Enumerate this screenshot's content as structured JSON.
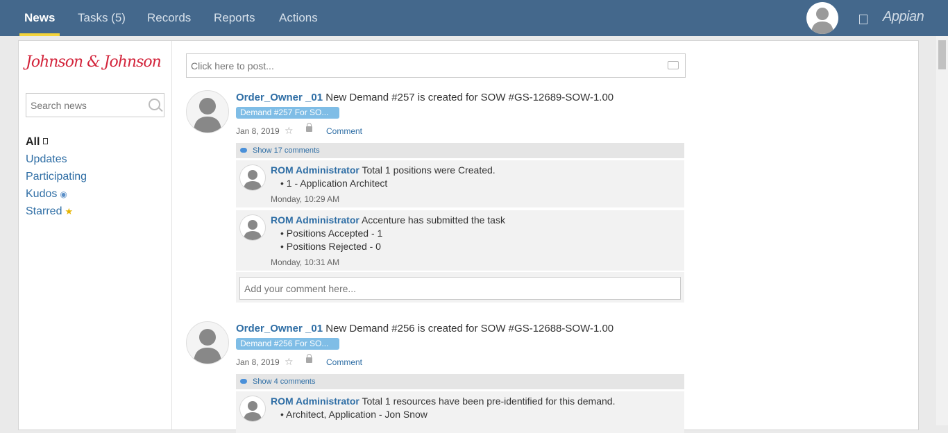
{
  "nav": {
    "tabs": [
      {
        "label": "News"
      },
      {
        "label": "Tasks (5)"
      },
      {
        "label": "Records"
      },
      {
        "label": "Reports"
      },
      {
        "label": "Actions"
      }
    ],
    "brand": "Appian"
  },
  "sidebar": {
    "logo": "Johnson & Johnson",
    "search_placeholder": "Search news",
    "filters": [
      {
        "label": "All"
      },
      {
        "label": "Updates"
      },
      {
        "label": "Participating"
      },
      {
        "label": "Kudos"
      },
      {
        "label": "Starred"
      }
    ]
  },
  "feed": {
    "post_placeholder": "Click here to post...",
    "comment_placeholder": "Add your comment here...",
    "entries": [
      {
        "user": "Order_Owner _01",
        "text": "New Demand #257 is created for SOW #GS-12689-SOW-1.00",
        "tag": "Demand #257 For SO...",
        "date": "Jan 8, 2019",
        "comment_label": "Comment",
        "show_comments": "Show 17 comments",
        "comments": [
          {
            "user": "ROM Administrator",
            "text": "Total 1 positions were Created.",
            "bullets": [
              "• 1 - Application Architect"
            ],
            "time": "Monday, 10:29 AM"
          },
          {
            "user": "ROM Administrator",
            "text": "Accenture has submitted the task",
            "bullets": [
              "• Positions Accepted - 1",
              "• Positions Rejected - 0"
            ],
            "time": "Monday, 10:31 AM"
          }
        ]
      },
      {
        "user": "Order_Owner _01",
        "text": "New Demand #256 is created for SOW #GS-12688-SOW-1.00",
        "tag": "Demand #256 For SO...",
        "date": "Jan 8, 2019",
        "comment_label": "Comment",
        "show_comments": "Show 4 comments",
        "comments": [
          {
            "user": "ROM Administrator",
            "text": "Total 1 resources have been pre-identified for this demand.",
            "bullets": [
              "• Architect, Application - Jon Snow"
            ]
          }
        ]
      }
    ]
  }
}
